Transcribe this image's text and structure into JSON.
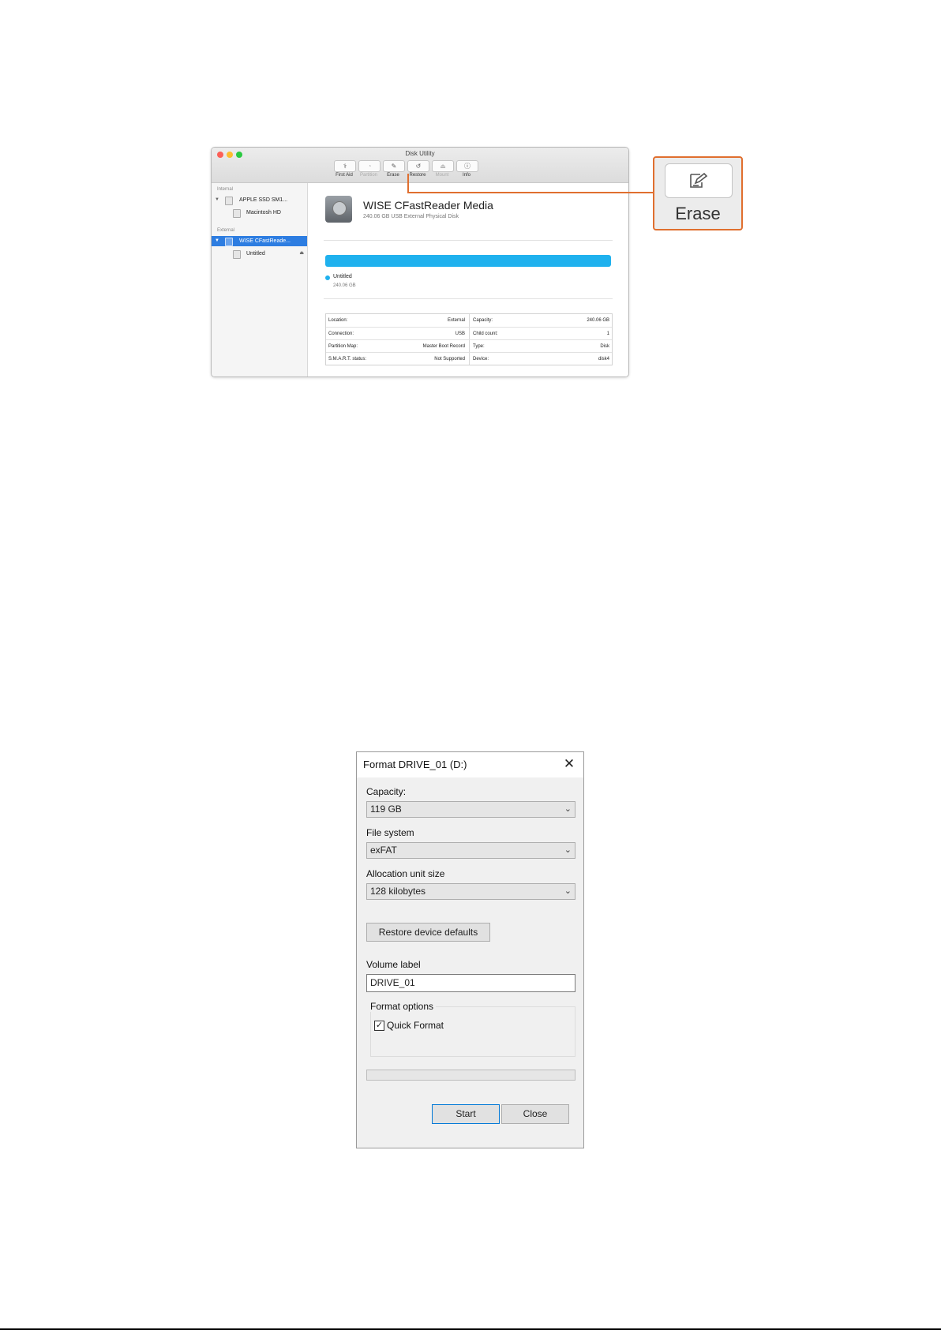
{
  "mac": {
    "title": "Disk Utility",
    "toolbar": [
      {
        "icon": "stethoscope-icon",
        "glyph": "⚕",
        "label": "First Aid",
        "enabled": true
      },
      {
        "icon": "partition-icon",
        "glyph": "◔",
        "label": "Partition",
        "enabled": false
      },
      {
        "icon": "erase-icon",
        "glyph": "✎",
        "label": "Erase",
        "enabled": true
      },
      {
        "icon": "restore-icon",
        "glyph": "↺",
        "label": "Restore",
        "enabled": true
      },
      {
        "icon": "mount-icon",
        "glyph": "⏏",
        "label": "Mount",
        "enabled": false
      },
      {
        "icon": "info-icon",
        "glyph": "ⓘ",
        "label": "Info",
        "enabled": true
      }
    ],
    "sidebar": {
      "internal_heading": "Internal",
      "external_heading": "External",
      "items": [
        {
          "label": "APPLE SSD SM1...",
          "level": 0,
          "expanded": true
        },
        {
          "label": "Macintosh HD",
          "level": 1
        },
        {
          "label": "WISE CFastReade...",
          "level": 0,
          "expanded": true,
          "selected": true
        },
        {
          "label": "Untitled",
          "level": 1,
          "ejectable": true
        }
      ]
    },
    "disk": {
      "name": "WISE CFastReader Media",
      "subtitle": "240.06 GB USB External Physical Disk",
      "partition_name": "Untitled",
      "partition_size": "240.06 GB"
    },
    "info": [
      {
        "lk": "Location:",
        "lv": "External",
        "rk": "Capacity:",
        "rv": "240.06 GB"
      },
      {
        "lk": "Connection:",
        "lv": "USB",
        "rk": "Child count:",
        "rv": "1"
      },
      {
        "lk": "Partition Map:",
        "lv": "Master Boot Record",
        "rk": "Type:",
        "rv": "Disk"
      },
      {
        "lk": "S.M.A.R.T. status:",
        "lv": "Not Supported",
        "rk": "Device:",
        "rv": "disk4"
      }
    ],
    "callout_label": "Erase"
  },
  "format_dialog": {
    "title": "Format DRIVE_01 (D:)",
    "capacity_label": "Capacity:",
    "capacity_value": "119 GB",
    "filesystem_label": "File system",
    "filesystem_value": "exFAT",
    "allocation_label": "Allocation unit size",
    "allocation_value": "128 kilobytes",
    "restore_label": "Restore device defaults",
    "volume_label_label": "Volume label",
    "volume_label_value": "DRIVE_01",
    "format_options_label": "Format options",
    "quick_format_label": "Quick Format",
    "quick_format_checked": true,
    "progress": 0,
    "start_label": "Start",
    "close_label": "Close"
  },
  "colors": {
    "accent_orange": "#e06f2f",
    "usage_blue": "#1fb1ee",
    "selection_blue": "#2d7de1"
  }
}
